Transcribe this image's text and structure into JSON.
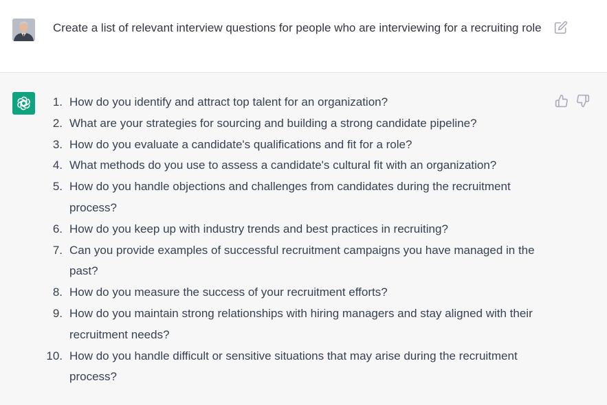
{
  "user_message": {
    "avatar_icon": "user-avatar-photo",
    "text": "Create a list of relevant interview questions for people who are interviewing for a recruiting role",
    "edit_icon": "edit-icon"
  },
  "assistant_message": {
    "logo_icon": "chatgpt-logo-icon",
    "accent_color": "#10a37f",
    "feedback": {
      "thumbs_up_icon": "thumbs-up-icon",
      "thumbs_down_icon": "thumbs-down-icon"
    },
    "items": [
      {
        "num": "1.",
        "text": "How do you identify and attract top talent for an organization?"
      },
      {
        "num": "2.",
        "text": "What are your strategies for sourcing and building a strong candidate pipeline?"
      },
      {
        "num": "3.",
        "text": "How do you evaluate a candidate's qualifications and fit for a role?"
      },
      {
        "num": "4.",
        "text": "What methods do you use to assess a candidate's cultural fit with an organization?"
      },
      {
        "num": "5.",
        "text": "How do you handle objections and challenges from candidates during the recruitment process?"
      },
      {
        "num": "6.",
        "text": "How do you keep up with industry trends and best practices in recruiting?"
      },
      {
        "num": "7.",
        "text": "Can you provide examples of successful recruitment campaigns you have managed in the past?"
      },
      {
        "num": "8.",
        "text": "How do you measure the success of your recruitment efforts?"
      },
      {
        "num": "9.",
        "text": "How do you maintain strong relationships with hiring managers and stay aligned with their recruitment needs?"
      },
      {
        "num": "10.",
        "text": "How do you handle difficult or sensitive situations that may arise during the recruitment process?"
      }
    ]
  }
}
